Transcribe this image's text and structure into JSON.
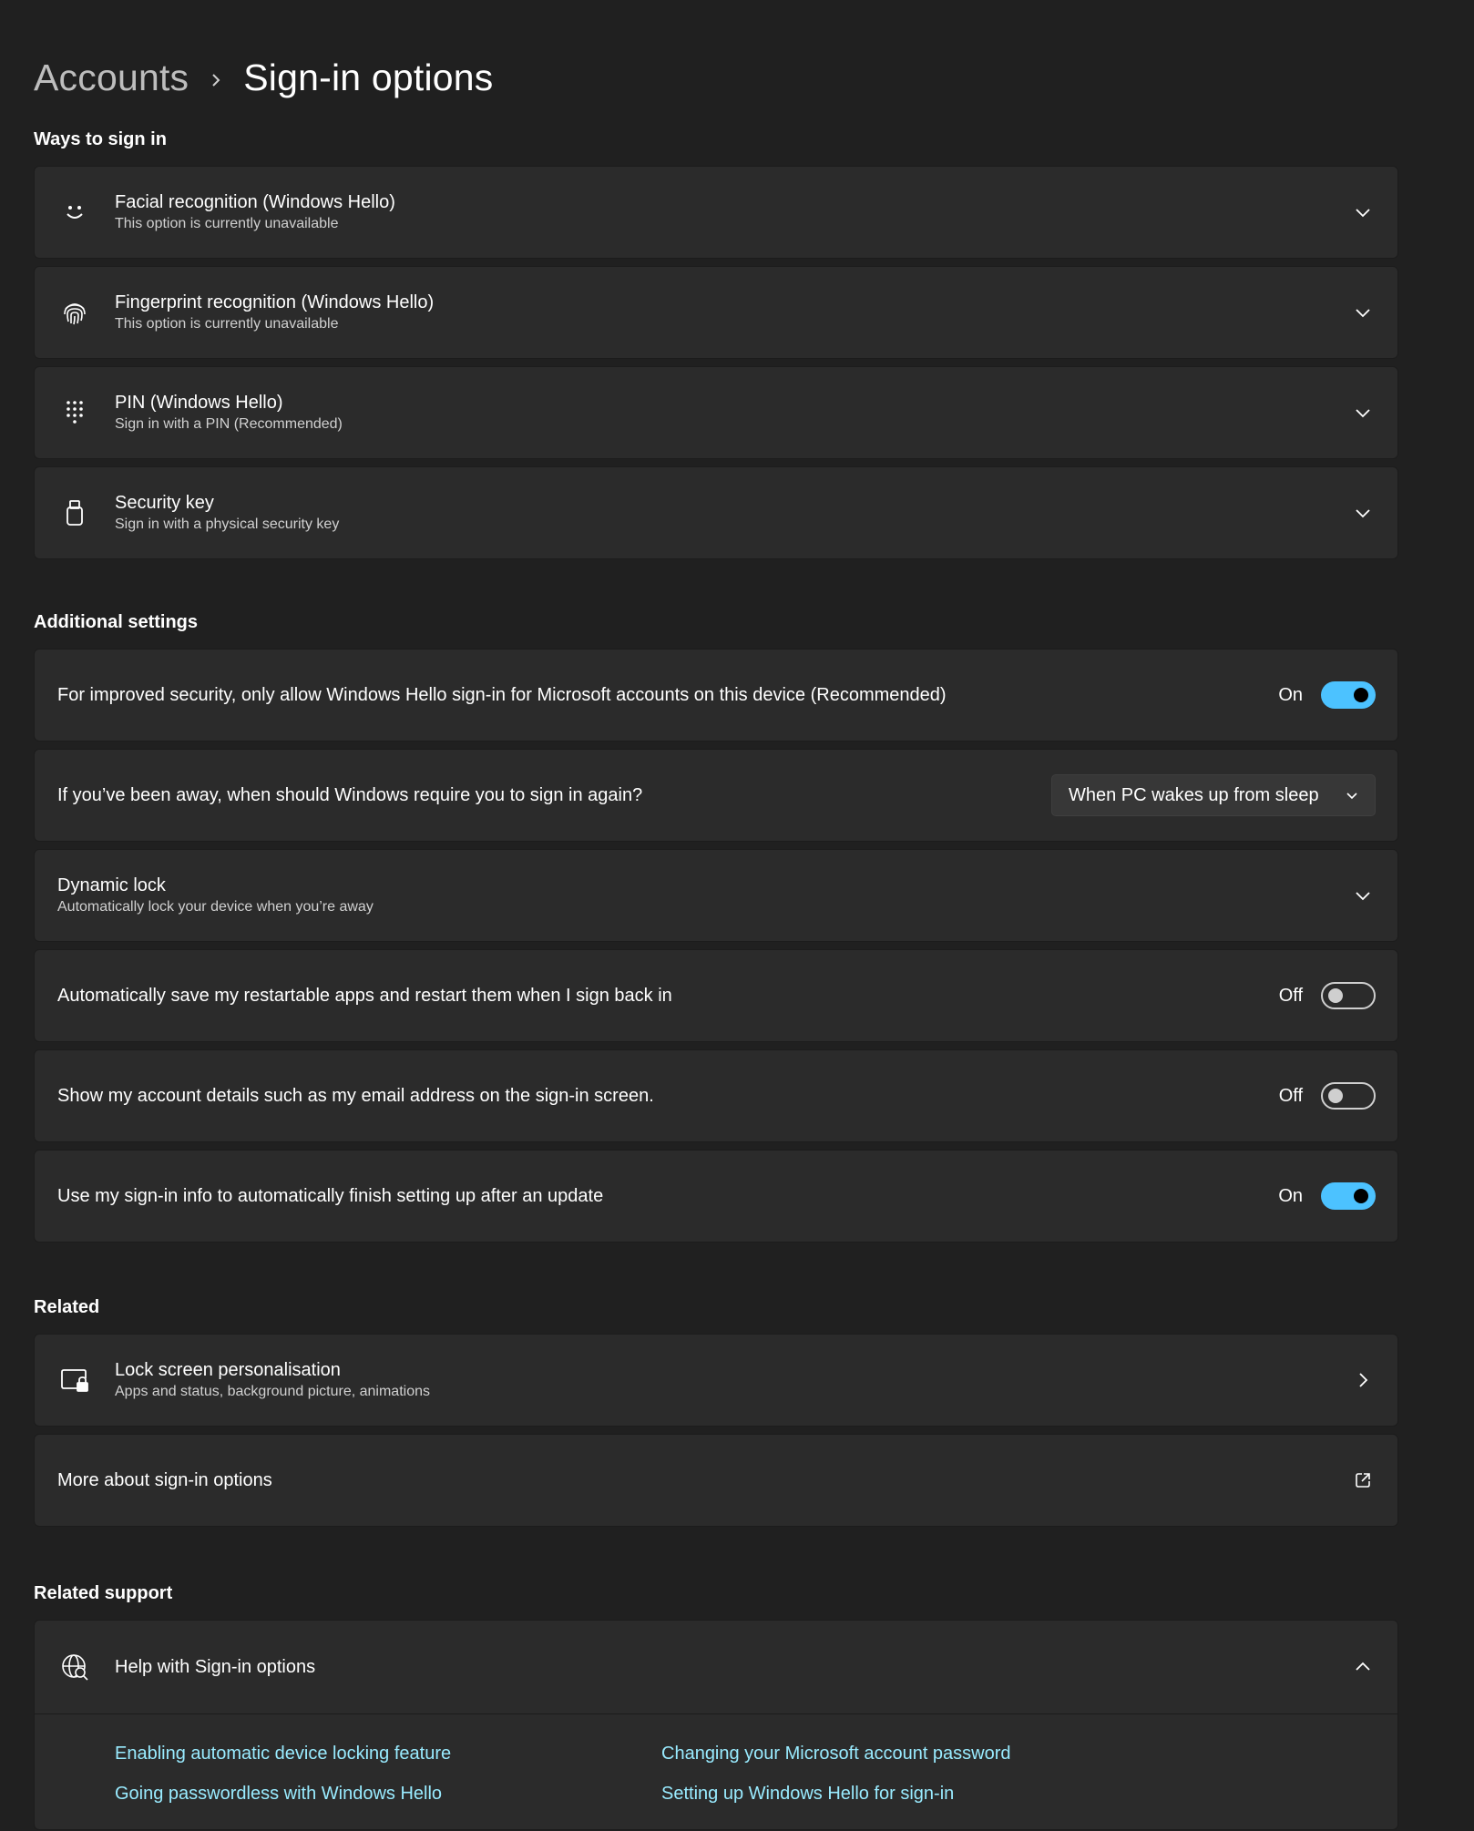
{
  "breadcrumb": {
    "parent": "Accounts",
    "current": "Sign-in options"
  },
  "ways_to_sign_in": {
    "title": "Ways to sign in",
    "items": [
      {
        "icon": "face-icon",
        "title": "Facial recognition (Windows Hello)",
        "subtitle": "This option is currently unavailable"
      },
      {
        "icon": "fingerprint-icon",
        "title": "Fingerprint recognition (Windows Hello)",
        "subtitle": "This option is currently unavailable"
      },
      {
        "icon": "pin-keypad-icon",
        "title": "PIN (Windows Hello)",
        "subtitle": "Sign in with a PIN (Recommended)"
      },
      {
        "icon": "usb-key-icon",
        "title": "Security key",
        "subtitle": "Sign in with a physical security key"
      }
    ]
  },
  "additional_settings": {
    "title": "Additional settings",
    "hello_only": {
      "label": "For improved security, only allow Windows Hello sign-in for Microsoft accounts on this device (Recommended)",
      "state": "On"
    },
    "require_signin": {
      "label": "If you’ve been away, when should Windows require you to sign in again?",
      "selected": "When PC wakes up from sleep"
    },
    "dynamic_lock": {
      "title": "Dynamic lock",
      "subtitle": "Automatically lock your device when you’re away"
    },
    "restart_apps": {
      "label": "Automatically save my restartable apps and restart them when I sign back in",
      "state": "Off"
    },
    "account_details": {
      "label": "Show my account details such as my email address on the sign-in screen.",
      "state": "Off"
    },
    "signin_info": {
      "label": "Use my sign-in info to automatically finish setting up after an update",
      "state": "On"
    }
  },
  "related": {
    "title": "Related",
    "lock_screen": {
      "title": "Lock screen personalisation",
      "subtitle": "Apps and status, background picture, animations"
    },
    "more_about": {
      "label": "More about sign-in options"
    }
  },
  "related_support": {
    "title": "Related support",
    "help": {
      "title": "Help with Sign-in options"
    },
    "links": [
      "Enabling automatic device locking feature",
      "Changing your Microsoft account password",
      "Going passwordless with Windows Hello",
      "Setting up Windows Hello for sign-in"
    ]
  },
  "colors": {
    "background": "#202020",
    "card": "#2b2b2b",
    "accent": "#4cc2ff",
    "link": "#99ebff"
  }
}
